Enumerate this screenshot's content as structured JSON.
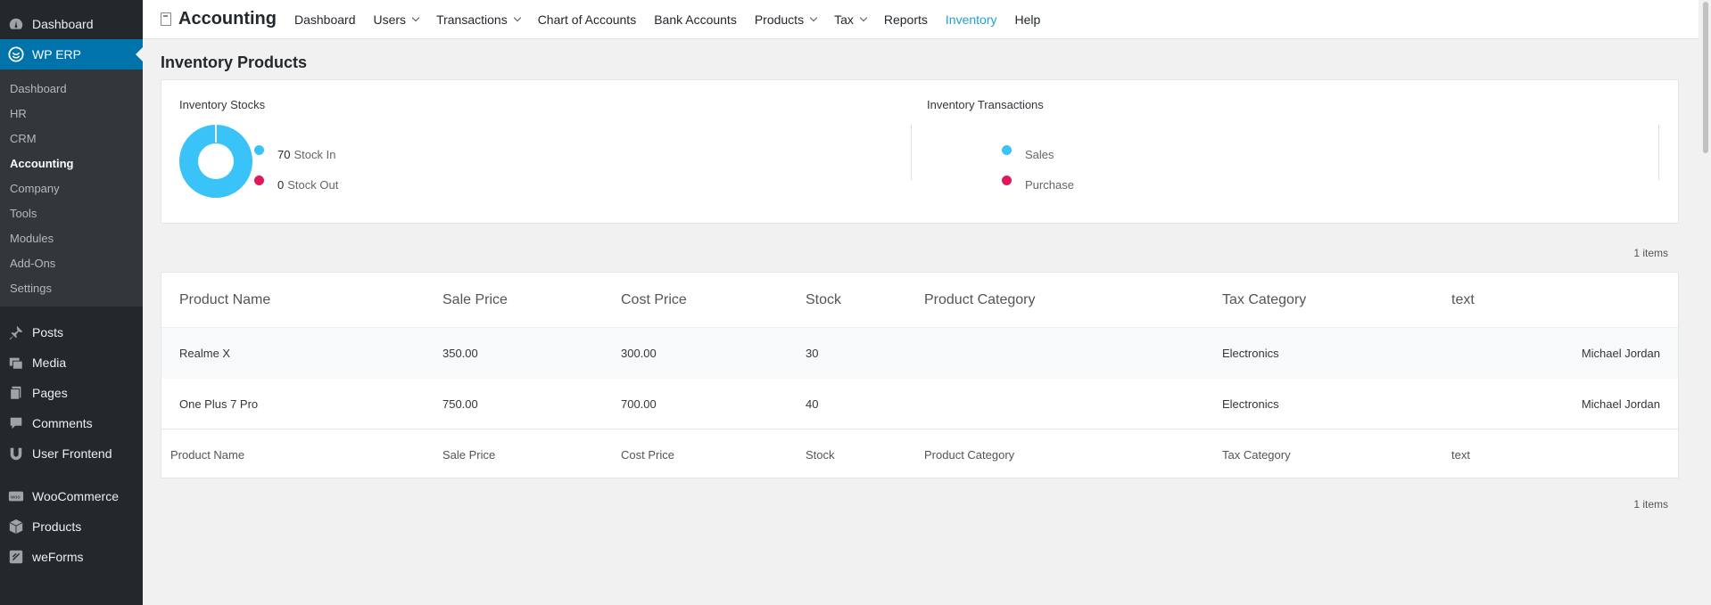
{
  "wp_menu": {
    "dashboard": "Dashboard",
    "wp_erp": "WP ERP",
    "submenu": [
      "Dashboard",
      "HR",
      "CRM",
      "Accounting",
      "Company",
      "Tools",
      "Modules",
      "Add-Ons",
      "Settings"
    ],
    "active_sub": "Accounting",
    "group1": [
      "Posts",
      "Media",
      "Pages",
      "Comments",
      "User Frontend"
    ],
    "group2": [
      "WooCommerce",
      "Products",
      "weForms"
    ]
  },
  "topnav": {
    "brand": "Accounting",
    "items": [
      "Dashboard",
      "Users",
      "Transactions",
      "Chart of Accounts",
      "Bank Accounts",
      "Products",
      "Tax",
      "Reports",
      "Inventory",
      "Help"
    ],
    "active": "Inventory"
  },
  "page": {
    "title": "Inventory Products",
    "stocks": {
      "title": "Inventory Stocks",
      "stock_in_value": "70",
      "stock_in_label": "Stock In",
      "stock_out_value": "0",
      "stock_out_label": "Stock Out",
      "stock_in_color": "#39c3f8",
      "stock_out_color": "#e0195c"
    },
    "transactions": {
      "title": "Inventory Transactions",
      "sales_label": "Sales",
      "purchase_label": "Purchase",
      "sales_color": "#39c3f8",
      "purchase_color": "#e0195c"
    },
    "items_count_top": "1 items",
    "items_count_bottom": "1 items",
    "table": {
      "columns": [
        "Product Name",
        "Sale Price",
        "Cost Price",
        "Stock",
        "Product Category",
        "Tax Category",
        "text"
      ],
      "rows": [
        [
          "Realme X",
          "350.00",
          "300.00",
          "30",
          "",
          "Electronics",
          "Michael Jordan"
        ],
        [
          "One Plus 7 Pro",
          "750.00",
          "700.00",
          "40",
          "",
          "Electronics",
          "Michael Jordan"
        ]
      ]
    }
  }
}
